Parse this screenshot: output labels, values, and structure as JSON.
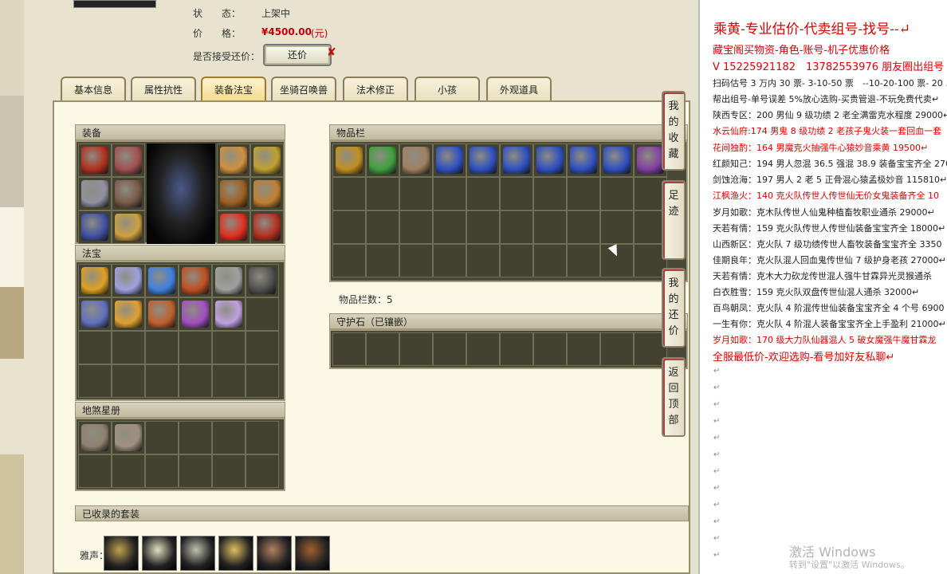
{
  "info": {
    "status_label": "状　　态：",
    "status_value": "上架中",
    "price_label": "价　　格：",
    "price_value": "¥4500.00",
    "price_suffix": "(元)",
    "counter_label": "是否接受还价：",
    "counter_button": "还价",
    "counter_x": "✘"
  },
  "tabs": [
    {
      "label": "基本信息"
    },
    {
      "label": "属性抗性"
    },
    {
      "label": "装备法宝"
    },
    {
      "label": "坐骑召唤兽"
    },
    {
      "label": "法术修正"
    },
    {
      "label": "小孩"
    },
    {
      "label": "外观道具"
    }
  ],
  "active_tab": "装备法宝",
  "sections": {
    "equipment": "装备",
    "fabao": "法宝",
    "inventory": "物品栏",
    "inventory_count": "物品栏数：5",
    "guardian": "守护石（已镶嵌）",
    "collection": "地煞星册",
    "suits": "已收录的套装",
    "suit_row_label": "雅声："
  },
  "side_buttons": [
    {
      "label": "我的收藏"
    },
    {
      "label": "足迹"
    },
    {
      "label": "我的还价"
    },
    {
      "label": "返回顶部"
    }
  ],
  "item_colors": {
    "equip": [
      "#b03020",
      "#a05050",
      "#9090a0",
      "#7a5a4a",
      "#4050a0",
      "#d0a040",
      "#d09040",
      "#c0a030",
      "#a06020",
      "#c08030",
      "#e03020"
    ],
    "fabao": [
      "#e0a020",
      "#a0a0e0",
      "#4080e0",
      "#c05020",
      "#a0a0a0",
      "#505050",
      "#6070c0",
      "#e0a030",
      "#c06030",
      "#a050c0",
      "#c0a0e0"
    ],
    "inventory": [
      "#c09020",
      "#40a040",
      "#a08060",
      "#3050c0",
      "#3050c0",
      "#3050c0",
      "#3050c0",
      "#3050c0",
      "#3050c0",
      "#8040a0"
    ],
    "collection": [
      "#908070",
      "#a09080"
    ],
    "suits": [
      "#c0a050",
      "#e0e0c0",
      "#c0c0b0",
      "#e0c060",
      "#b08060",
      "#a06030"
    ]
  },
  "doc": {
    "title": "乘黄-专业估价-代卖组号-找号--↵",
    "lines": [
      {
        "text": "藏宝阁买物资-角色-账号-机子优惠价格",
        "cls": "red big"
      },
      {
        "text": "V 15225921182　13782553976 朋友圈出组号",
        "cls": "red big"
      },
      {
        "text": "扫码估号 3 万内 30 票- 3-10-50 票　--10-20-100 票- 20 以上 1",
        "cls": "black"
      },
      {
        "text": "帮出组号-单号误差 5%放心选购-买贵管退-不玩免费代卖↵",
        "cls": "black"
      },
      {
        "text": "陕西专区：200 男仙 9 级功绩 2 老全满雷克水程度 29000↵",
        "cls": "black"
      },
      {
        "text": "水云仙府:174 男鬼 8 级功绩 2 老孩子鬼火装一套回血一套",
        "cls": "red"
      },
      {
        "text": "花间独酌：164 男魔克火抽强牛心猿妙音乘黄 19500↵",
        "cls": "red"
      },
      {
        "text": "红颜知己：194 男人忽混 36.5 强混 38.9 装备宝宝齐全 2700",
        "cls": "black"
      },
      {
        "text": "剑蚀沧海：197 男人 2 老 5 正骨混心猿孟极妙音 115810↵",
        "cls": "black"
      },
      {
        "text": "江枫渔火：140 克火队传世人传世仙无价女鬼装备齐全 10",
        "cls": "red"
      },
      {
        "text": "岁月如歌：克木队传世人仙鬼种植畜牧职业通杀 29000↵",
        "cls": "black"
      },
      {
        "text": "天若有情：159 克火队传世人传世仙装备宝宝齐全 18000↵",
        "cls": "black"
      },
      {
        "text": "山西新区：克火队 7 级功绩传世人畜牧装备宝宝齐全 3350",
        "cls": "black"
      },
      {
        "text": "佳期良年：克火队混人回血鬼传世仙 7 级护身老孩 27000↵",
        "cls": "black"
      },
      {
        "text": "天若有情：克木大力砍龙传世混人强牛甘霖异光灵猴通杀",
        "cls": "black"
      },
      {
        "text": "白衣胜雪：159 克火队双盘传世仙混人通杀 32000↵",
        "cls": "black"
      },
      {
        "text": "百鸟朝凤：克火队 4 阶混传世仙装备宝宝齐全 4 个号 6900",
        "cls": "black"
      },
      {
        "text": "一生有你：克火队 4 阶混人装备宝宝齐全上手盈利 21000↵",
        "cls": "black"
      },
      {
        "text": "岁月如歌：170 级大力队仙器混人 5 破女魔强牛魔甘霖龙",
        "cls": "red"
      },
      {
        "text": "全服最低价-欢迎选购-看号加好友私聊↵",
        "cls": "red big"
      }
    ],
    "para_mark": "↵",
    "watermark_title": "激活 Windows",
    "watermark_sub": "转到\"设置\"以激活 Windows。"
  }
}
